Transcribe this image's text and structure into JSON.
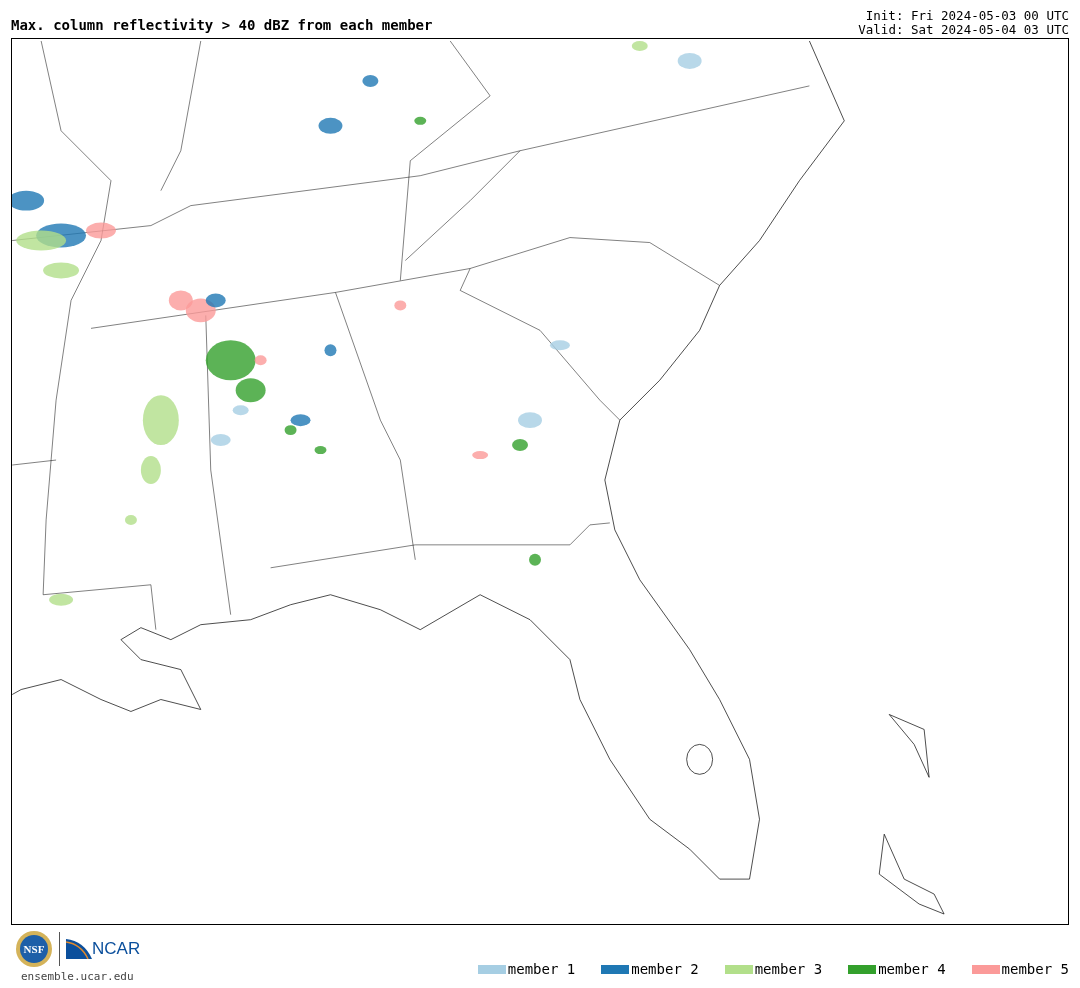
{
  "header": {
    "title": "Max. column reflectivity > 40 dBZ from each member",
    "init": "Init: Fri 2024-05-03 00 UTC",
    "valid": "Valid: Sat 2024-05-04 03 UTC"
  },
  "footer": {
    "nsf_logo_text": "NSF",
    "ncar_logo_text": "NCAR",
    "site": "ensemble.ucar.edu"
  },
  "legend": [
    {
      "label": "member 1",
      "color": "#a6cee3"
    },
    {
      "label": "member 2",
      "color": "#1f78b4"
    },
    {
      "label": "member 3",
      "color": "#b2df8a"
    },
    {
      "label": "member 4",
      "color": "#33a02c"
    },
    {
      "label": "member 5",
      "color": "#fb9a99"
    }
  ]
}
